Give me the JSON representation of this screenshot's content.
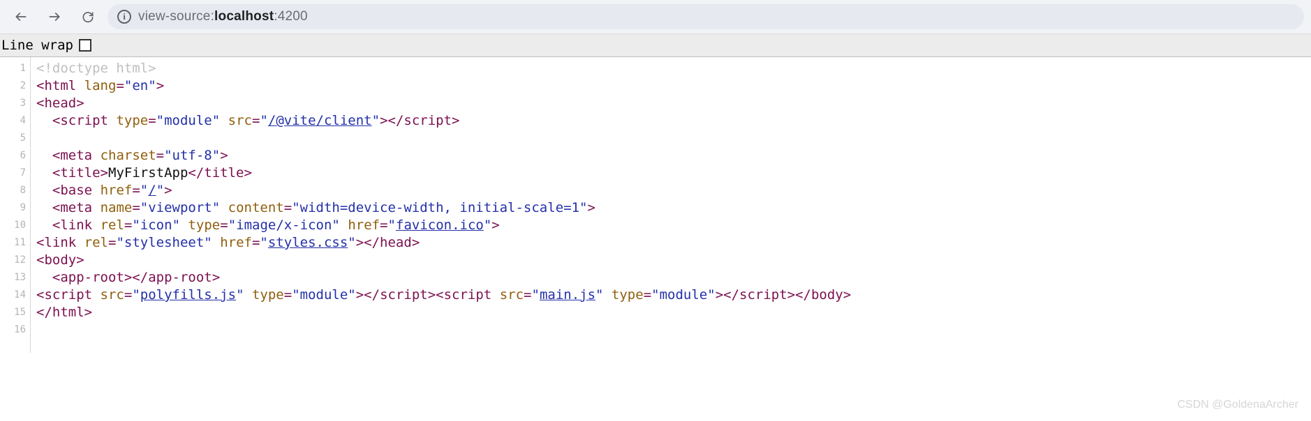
{
  "browser": {
    "url_prefix": "view-source:",
    "url_host": "localhost",
    "url_port": ":4200"
  },
  "toolbar": {
    "linewrap_label": "Line wrap",
    "linewrap_checked": false
  },
  "lines": [
    "1",
    "2",
    "3",
    "4",
    "5",
    "6",
    "7",
    "8",
    "9",
    "10",
    "11",
    "12",
    "13",
    "14",
    "15",
    "16"
  ],
  "source": {
    "doctype": "<!doctype html>",
    "html_open": {
      "tag": "html",
      "attr": "lang",
      "val": "en"
    },
    "head_open": "head",
    "script_module": {
      "tag": "script",
      "a1": "type",
      "v1": "module",
      "a2": "src",
      "v2": "/@vite/client"
    },
    "meta_charset": {
      "tag": "meta",
      "a": "charset",
      "v": "utf-8"
    },
    "title": {
      "tag": "title",
      "text": "MyFirstApp"
    },
    "base": {
      "tag": "base",
      "a": "href",
      "v": "/"
    },
    "meta_vp": {
      "tag": "meta",
      "a1": "name",
      "v1": "viewport",
      "a2": "content",
      "v2": "width=device-width, initial-scale=1"
    },
    "link_icon": {
      "tag": "link",
      "a1": "rel",
      "v1": "icon",
      "a2": "type",
      "v2": "image/x-icon",
      "a3": "href",
      "v3": "favicon.ico"
    },
    "link_css": {
      "tag": "link",
      "a1": "rel",
      "v1": "stylesheet",
      "a2": "href",
      "v2": "styles.css"
    },
    "head_close": "head",
    "body_open": "body",
    "app_root": "app-root",
    "script_poly": {
      "tag": "script",
      "a1": "src",
      "v1": "polyfills.js",
      "a2": "type",
      "v2": "module"
    },
    "script_main": {
      "tag": "script",
      "a1": "src",
      "v1": "main.js",
      "a2": "type",
      "v2": "module"
    },
    "body_close": "body",
    "html_close": "html"
  },
  "watermark": "CSDN @GoldenaArcher"
}
